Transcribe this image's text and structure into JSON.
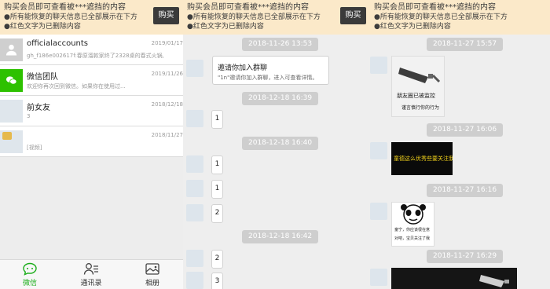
{
  "banner": {
    "title": "购买会员即可查看被***遮挡的内容",
    "line1": "●所有能恢复的聊天信息已全部展示在下方",
    "line2": "●红色文字为已删除内容",
    "buy_label": "购买"
  },
  "chat_list": [
    {
      "name": "officialaccounts",
      "time": "2019/01/17",
      "preview": "gh_f186e002617f:春原溜款家终了2328桌的春式火锅,"
    },
    {
      "name": "微信团队",
      "time": "2019/11/26",
      "preview": "欢迎你再次回到微信。如果你在使用过..."
    },
    {
      "name": "前女友",
      "time": "2018/12/18",
      "preview": "3"
    },
    {
      "name": "",
      "time": "2018/11/27",
      "preview": "[视频]"
    }
  ],
  "tabs": [
    {
      "label": "微信",
      "icon": "chat-bubble-icon"
    },
    {
      "label": "通讯录",
      "icon": "contacts-icon"
    },
    {
      "label": "相册",
      "icon": "album-icon"
    }
  ],
  "chat2": {
    "times": [
      "2018-11-26 13:53",
      "2018-12-18 16:39",
      "2018-12-18 16:40",
      "2018-12-18 16:42"
    ],
    "invite_title": "邀请你加入群聊",
    "invite_desc": "\"1n\"邀请你加入群聊，进入可查看详情。",
    "messages": [
      "1",
      "1",
      "1",
      "2",
      "2",
      "3"
    ]
  },
  "chat3": {
    "times": [
      "2018-11-27 15:57",
      "2018-11-27 16:06",
      "2018-11-27 16:16",
      "2018-11-27 16:29"
    ],
    "meme1_text": "朋友圈已被监控",
    "meme1_sub": "谨言慎行你的行为",
    "meme2_text": "童德这么优秀些要关注我",
    "meme3_text": "童宁，你应该很在意",
    "meme3_sub": "对吧，宝贝关注了我"
  },
  "colors": {
    "banner_bg": "#fbe9c9",
    "buy_bg": "#3a3a3a",
    "wechat_green": "#1aad19",
    "time_stamp_bg": "#cecece"
  }
}
